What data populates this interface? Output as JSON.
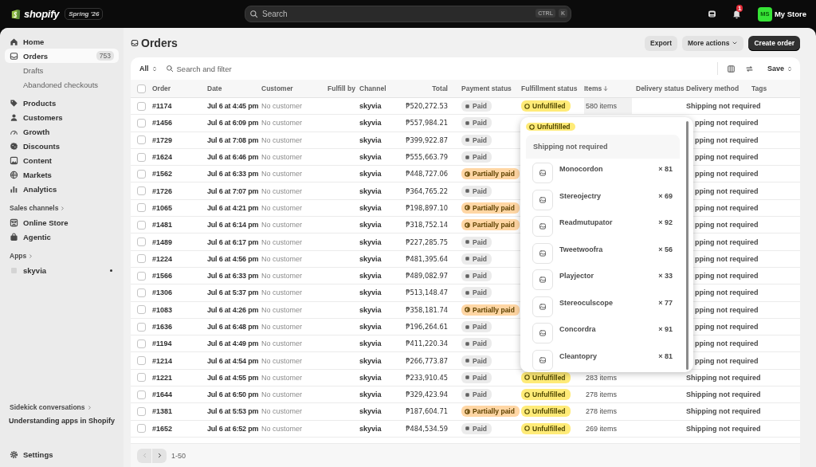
{
  "topbar": {
    "brand": "shopify",
    "edition": "Spring '26",
    "search": {
      "placeholder": "Search",
      "shortcut": [
        "CTRL",
        "K"
      ]
    },
    "notifications": "1",
    "avatar": "MS",
    "store": "My Store"
  },
  "sidebar": {
    "sections": [
      {
        "items": [
          {
            "label": "Home",
            "selected": false
          },
          {
            "label": "Orders",
            "selected": true,
            "count": "753",
            "children": [
              {
                "label": "Drafts",
                "selected": false
              },
              {
                "label": "Abandoned checkouts",
                "selected": false
              }
            ]
          }
        ]
      },
      {
        "items": [
          {
            "label": "Products",
            "selected": false
          },
          {
            "label": "Customers",
            "selected": false
          },
          {
            "label": "Growth",
            "selected": false
          },
          {
            "label": "Discounts",
            "selected": false
          },
          {
            "label": "Content",
            "selected": false
          },
          {
            "label": "Markets",
            "selected": false
          },
          {
            "label": "Analytics",
            "selected": false
          }
        ]
      },
      {
        "heading": "Sales channels",
        "items": [
          {
            "label": "Online Store",
            "selected": false
          },
          {
            "label": "Agentic",
            "selected": false
          }
        ]
      },
      {
        "heading": "Apps",
        "items": [
          {
            "label": "skyvia",
            "selected": false,
            "pinned": true
          }
        ]
      }
    ],
    "sidekick": {
      "heading": "Sidekick conversations",
      "items": [
        "Understanding apps in Shopify"
      ]
    },
    "settings": "Settings"
  },
  "page": {
    "title": "Orders",
    "buttons": [
      {
        "label": "Export",
        "kind": "secondary"
      },
      {
        "label": "More actions",
        "kind": "menu"
      },
      {
        "label": "Create order",
        "kind": "primary"
      }
    ]
  },
  "toolbar": {
    "view": "All",
    "search": {
      "placeholder": "Search and filter"
    },
    "save": "Save"
  },
  "table": {
    "select_all_checked": false,
    "columns": [
      {
        "label": "Order",
        "sorted": false
      },
      {
        "label": "Date",
        "sorted": false
      },
      {
        "label": "Customer",
        "sorted": false
      },
      {
        "label": "Fulfill by",
        "sorted": false
      },
      {
        "label": "Channel",
        "sorted": false
      },
      {
        "label": "Total",
        "sorted": false
      },
      {
        "label": "Payment status",
        "sorted": false
      },
      {
        "label": "Fulfillment status",
        "sorted": false
      },
      {
        "label": "Items",
        "sorted": true
      },
      {
        "label": "Delivery status",
        "sorted": false
      },
      {
        "label": "Delivery method",
        "sorted": false
      },
      {
        "label": "Tags",
        "sorted": false
      }
    ],
    "rows": [
      {
        "checked": false,
        "covered": false,
        "order": "#1174",
        "date": "Jul 6 at 4:45 pm",
        "customer": "No customer",
        "channel": "skyvia",
        "total": "₱520,272.53",
        "payment": {
          "label": "Paid",
          "kind": "paid"
        },
        "fulfillment": {
          "label": "Unfulfilled",
          "kind": "unfulfilled"
        },
        "items": {
          "label": "580 items",
          "open": true
        },
        "delivery_method": "Shipping not required"
      },
      {
        "checked": false,
        "covered": true,
        "order": "#1456",
        "date": "Jul 6 at 6:09 pm",
        "customer": "No customer",
        "channel": "skyvia",
        "total": "₱557,984.21",
        "payment": {
          "label": "Paid",
          "kind": "paid"
        },
        "delivery_method": "pping not required"
      },
      {
        "checked": false,
        "covered": true,
        "order": "#1729",
        "date": "Jul 6 at 7:08 pm",
        "customer": "No customer",
        "channel": "skyvia",
        "total": "₱399,922.87",
        "payment": {
          "label": "Paid",
          "kind": "paid"
        },
        "delivery_method": "pping not required"
      },
      {
        "checked": false,
        "covered": true,
        "order": "#1624",
        "date": "Jul 6 at 6:46 pm",
        "customer": "No customer",
        "channel": "skyvia",
        "total": "₱555,663.79",
        "payment": {
          "label": "Paid",
          "kind": "paid"
        },
        "delivery_method": "pping not required"
      },
      {
        "checked": false,
        "covered": true,
        "order": "#1562",
        "date": "Jul 6 at 6:33 pm",
        "customer": "No customer",
        "channel": "skyvia",
        "total": "₱448,727.06",
        "payment": {
          "label": "Partially paid",
          "kind": "partial"
        },
        "delivery_method": "pping not required"
      },
      {
        "checked": false,
        "covered": true,
        "order": "#1726",
        "date": "Jul 6 at 7:07 pm",
        "customer": "No customer",
        "channel": "skyvia",
        "total": "₱364,765.22",
        "payment": {
          "label": "Paid",
          "kind": "paid"
        },
        "delivery_method": "pping not required"
      },
      {
        "checked": false,
        "covered": true,
        "order": "#1065",
        "date": "Jul 6 at 4:21 pm",
        "customer": "No customer",
        "channel": "skyvia",
        "total": "₱198,897.10",
        "payment": {
          "label": "Partially paid",
          "kind": "partial"
        },
        "delivery_method": "pping not required"
      },
      {
        "checked": false,
        "covered": true,
        "order": "#1481",
        "date": "Jul 6 at 6:14 pm",
        "customer": "No customer",
        "channel": "skyvia",
        "total": "₱318,752.14",
        "payment": {
          "label": "Partially paid",
          "kind": "partial"
        },
        "delivery_method": "pping not required"
      },
      {
        "checked": false,
        "covered": true,
        "order": "#1489",
        "date": "Jul 6 at 6:17 pm",
        "customer": "No customer",
        "channel": "skyvia",
        "total": "₱227,285.75",
        "payment": {
          "label": "Paid",
          "kind": "paid"
        },
        "delivery_method": "pping not required"
      },
      {
        "checked": false,
        "covered": true,
        "order": "#1224",
        "date": "Jul 6 at 4:56 pm",
        "customer": "No customer",
        "channel": "skyvia",
        "total": "₱481,395.64",
        "payment": {
          "label": "Paid",
          "kind": "paid"
        },
        "delivery_method": "pping not required"
      },
      {
        "checked": false,
        "covered": true,
        "order": "#1566",
        "date": "Jul 6 at 6:33 pm",
        "customer": "No customer",
        "channel": "skyvia",
        "total": "₱489,082.97",
        "payment": {
          "label": "Paid",
          "kind": "paid"
        },
        "delivery_method": "pping not required"
      },
      {
        "checked": false,
        "covered": true,
        "order": "#1306",
        "date": "Jul 6 at 5:37 pm",
        "customer": "No customer",
        "channel": "skyvia",
        "total": "₱513,148.47",
        "payment": {
          "label": "Paid",
          "kind": "paid"
        },
        "delivery_method": "pping not required"
      },
      {
        "checked": false,
        "covered": true,
        "order": "#1083",
        "date": "Jul 6 at 4:26 pm",
        "customer": "No customer",
        "channel": "skyvia",
        "total": "₱358,181.74",
        "payment": {
          "label": "Partially paid",
          "kind": "partial"
        },
        "delivery_method": "pping not required"
      },
      {
        "checked": false,
        "covered": true,
        "order": "#1636",
        "date": "Jul 6 at 6:48 pm",
        "customer": "No customer",
        "channel": "skyvia",
        "total": "₱196,264.61",
        "payment": {
          "label": "Paid",
          "kind": "paid"
        },
        "delivery_method": "pping not required"
      },
      {
        "checked": false,
        "covered": true,
        "order": "#1194",
        "date": "Jul 6 at 4:49 pm",
        "customer": "No customer",
        "channel": "skyvia",
        "total": "₱411,220.34",
        "payment": {
          "label": "Paid",
          "kind": "paid"
        },
        "delivery_method": "pping not required"
      },
      {
        "checked": false,
        "covered": true,
        "order": "#1214",
        "date": "Jul 6 at 4:54 pm",
        "customer": "No customer",
        "channel": "skyvia",
        "total": "₱266,773.87",
        "payment": {
          "label": "Paid",
          "kind": "paid"
        },
        "delivery_method": "pping not required"
      },
      {
        "checked": false,
        "covered": false,
        "order": "#1221",
        "date": "Jul 6 at 4:55 pm",
        "customer": "No customer",
        "channel": "skyvia",
        "total": "₱233,910.45",
        "payment": {
          "label": "Paid",
          "kind": "paid"
        },
        "fulfillment": {
          "label": "Unfulfilled",
          "kind": "unfulfilled"
        },
        "items": {
          "label": "283 items",
          "open": false
        },
        "delivery_method": "Shipping not required"
      },
      {
        "checked": false,
        "covered": false,
        "order": "#1644",
        "date": "Jul 6 at 6:50 pm",
        "customer": "No customer",
        "channel": "skyvia",
        "total": "₱329,423.94",
        "payment": {
          "label": "Paid",
          "kind": "paid"
        },
        "fulfillment": {
          "label": "Unfulfilled",
          "kind": "unfulfilled"
        },
        "items": {
          "label": "278 items",
          "open": false
        },
        "delivery_method": "Shipping not required"
      },
      {
        "checked": false,
        "covered": false,
        "order": "#1381",
        "date": "Jul 6 at 5:53 pm",
        "customer": "No customer",
        "channel": "skyvia",
        "total": "₱187,604.71",
        "payment": {
          "label": "Partially paid",
          "kind": "partial"
        },
        "fulfillment": {
          "label": "Unfulfilled",
          "kind": "unfulfilled"
        },
        "items": {
          "label": "278 items",
          "open": false
        },
        "delivery_method": "Shipping not required"
      },
      {
        "checked": false,
        "covered": false,
        "order": "#1652",
        "date": "Jul 6 at 6:52 pm",
        "customer": "No customer",
        "channel": "skyvia",
        "total": "₱484,534.59",
        "payment": {
          "label": "Paid",
          "kind": "paid"
        },
        "fulfillment": {
          "label": "Unfulfilled",
          "kind": "unfulfilled"
        },
        "items": {
          "label": "269 items",
          "open": false
        },
        "delivery_method": "Shipping not required"
      }
    ]
  },
  "popover": {
    "status": {
      "label": "Unfulfilled",
      "kind": "unfulfilled"
    },
    "group": "Shipping not required",
    "items": [
      {
        "name": "Monocordon",
        "quantity": "× 81"
      },
      {
        "name": "Stereojectry",
        "quantity": "× 69"
      },
      {
        "name": "Readmutupator",
        "quantity": "× 92"
      },
      {
        "name": "Tweetwoofra",
        "quantity": "× 56"
      },
      {
        "name": "Playjector",
        "quantity": "× 33"
      },
      {
        "name": "Stereoculscope",
        "quantity": "× 77"
      },
      {
        "name": "Concordra",
        "quantity": "× 91"
      },
      {
        "name": "Cleantopry",
        "quantity": "× 81"
      }
    ]
  },
  "pagination": {
    "range": "1-50",
    "previous_disabled": true,
    "next_disabled": false
  }
}
